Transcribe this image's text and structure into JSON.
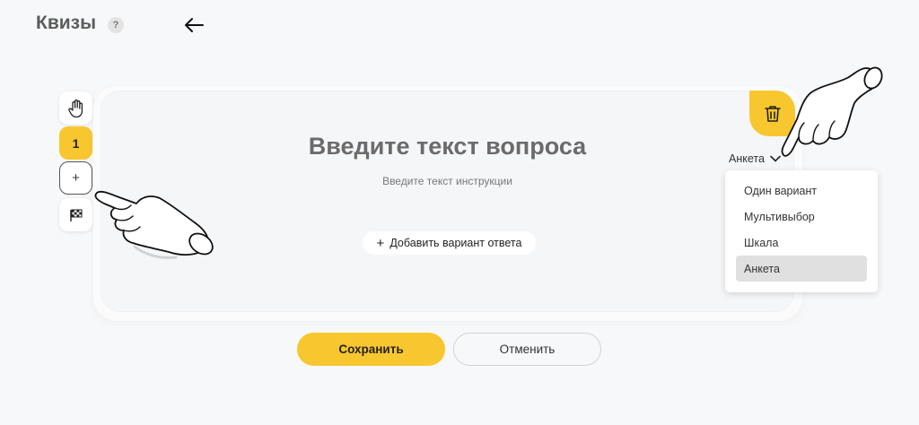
{
  "header": {
    "title": "Квизы",
    "help_label": "?"
  },
  "sidebar": {
    "items": [
      {
        "label": "",
        "icon": "hand-wave-icon"
      },
      {
        "label": "1",
        "icon": ""
      },
      {
        "label": "+",
        "icon": "plus-icon"
      },
      {
        "label": "",
        "icon": "finish-flag-icon"
      }
    ]
  },
  "question": {
    "title": "Введите текст вопроса",
    "instruction": "Введите текст инструкции",
    "add_answer_label": "Добавить вариант ответа",
    "type_selected": "Анкета",
    "type_options": [
      "Один вариант",
      "Мультивыбор",
      "Шкала",
      "Анкета"
    ]
  },
  "actions": {
    "save_label": "Сохранить",
    "cancel_label": "Отменить"
  },
  "colors": {
    "accent": "#f8c72f",
    "background": "#f7f8fa",
    "text_dark": "#333333"
  }
}
